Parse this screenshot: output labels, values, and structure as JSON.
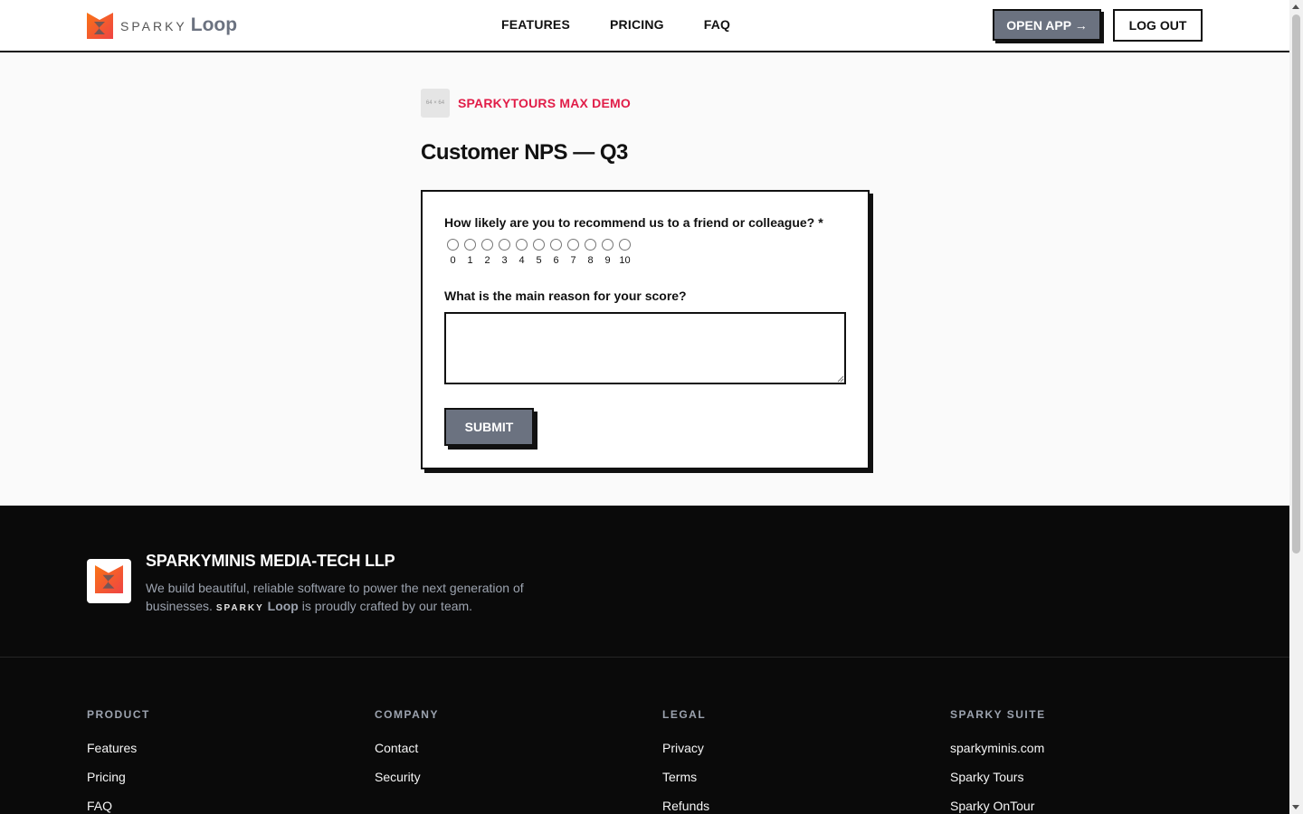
{
  "header": {
    "logo_sparky": "SPARKY",
    "logo_loop": "Loop",
    "nav": [
      "FEATURES",
      "PRICING",
      "FAQ"
    ],
    "open_app_label": "OPEN APP →",
    "logout_label": "LOG OUT"
  },
  "org": {
    "avatar_text": "64 × 64",
    "name": "SPARKYTOURS MAX DEMO"
  },
  "survey": {
    "title": "Customer NPS — Q3",
    "q1": "How likely are you to recommend us to a friend or colleague?",
    "q1_required": "*",
    "scale": [
      "0",
      "1",
      "2",
      "3",
      "4",
      "5",
      "6",
      "7",
      "8",
      "9",
      "10"
    ],
    "q2": "What is the main reason for your score?",
    "q2_value": "",
    "submit_label": "SUBMIT"
  },
  "footer": {
    "company": "SPARKYMINIS MEDIA-TECH LLP",
    "desc_before": "We build beautiful, reliable software to power the next generation of businesses.",
    "desc_sparky": "SPARKY",
    "desc_loop": "Loop",
    "desc_after": "is proudly crafted by our team.",
    "columns": [
      {
        "heading": "PRODUCT",
        "links": [
          "Features",
          "Pricing",
          "FAQ"
        ]
      },
      {
        "heading": "COMPANY",
        "links": [
          "Contact",
          "Security"
        ]
      },
      {
        "heading": "LEGAL",
        "links": [
          "Privacy",
          "Terms",
          "Refunds"
        ]
      },
      {
        "heading": "SPARKY SUITE",
        "links": [
          "sparkyminis.com",
          "Sparky Tours",
          "Sparky OnTour"
        ]
      }
    ]
  },
  "colors": {
    "accent": "#e11d48",
    "button_gray": "#6b7280",
    "footer_bg": "#0a0a0a"
  }
}
